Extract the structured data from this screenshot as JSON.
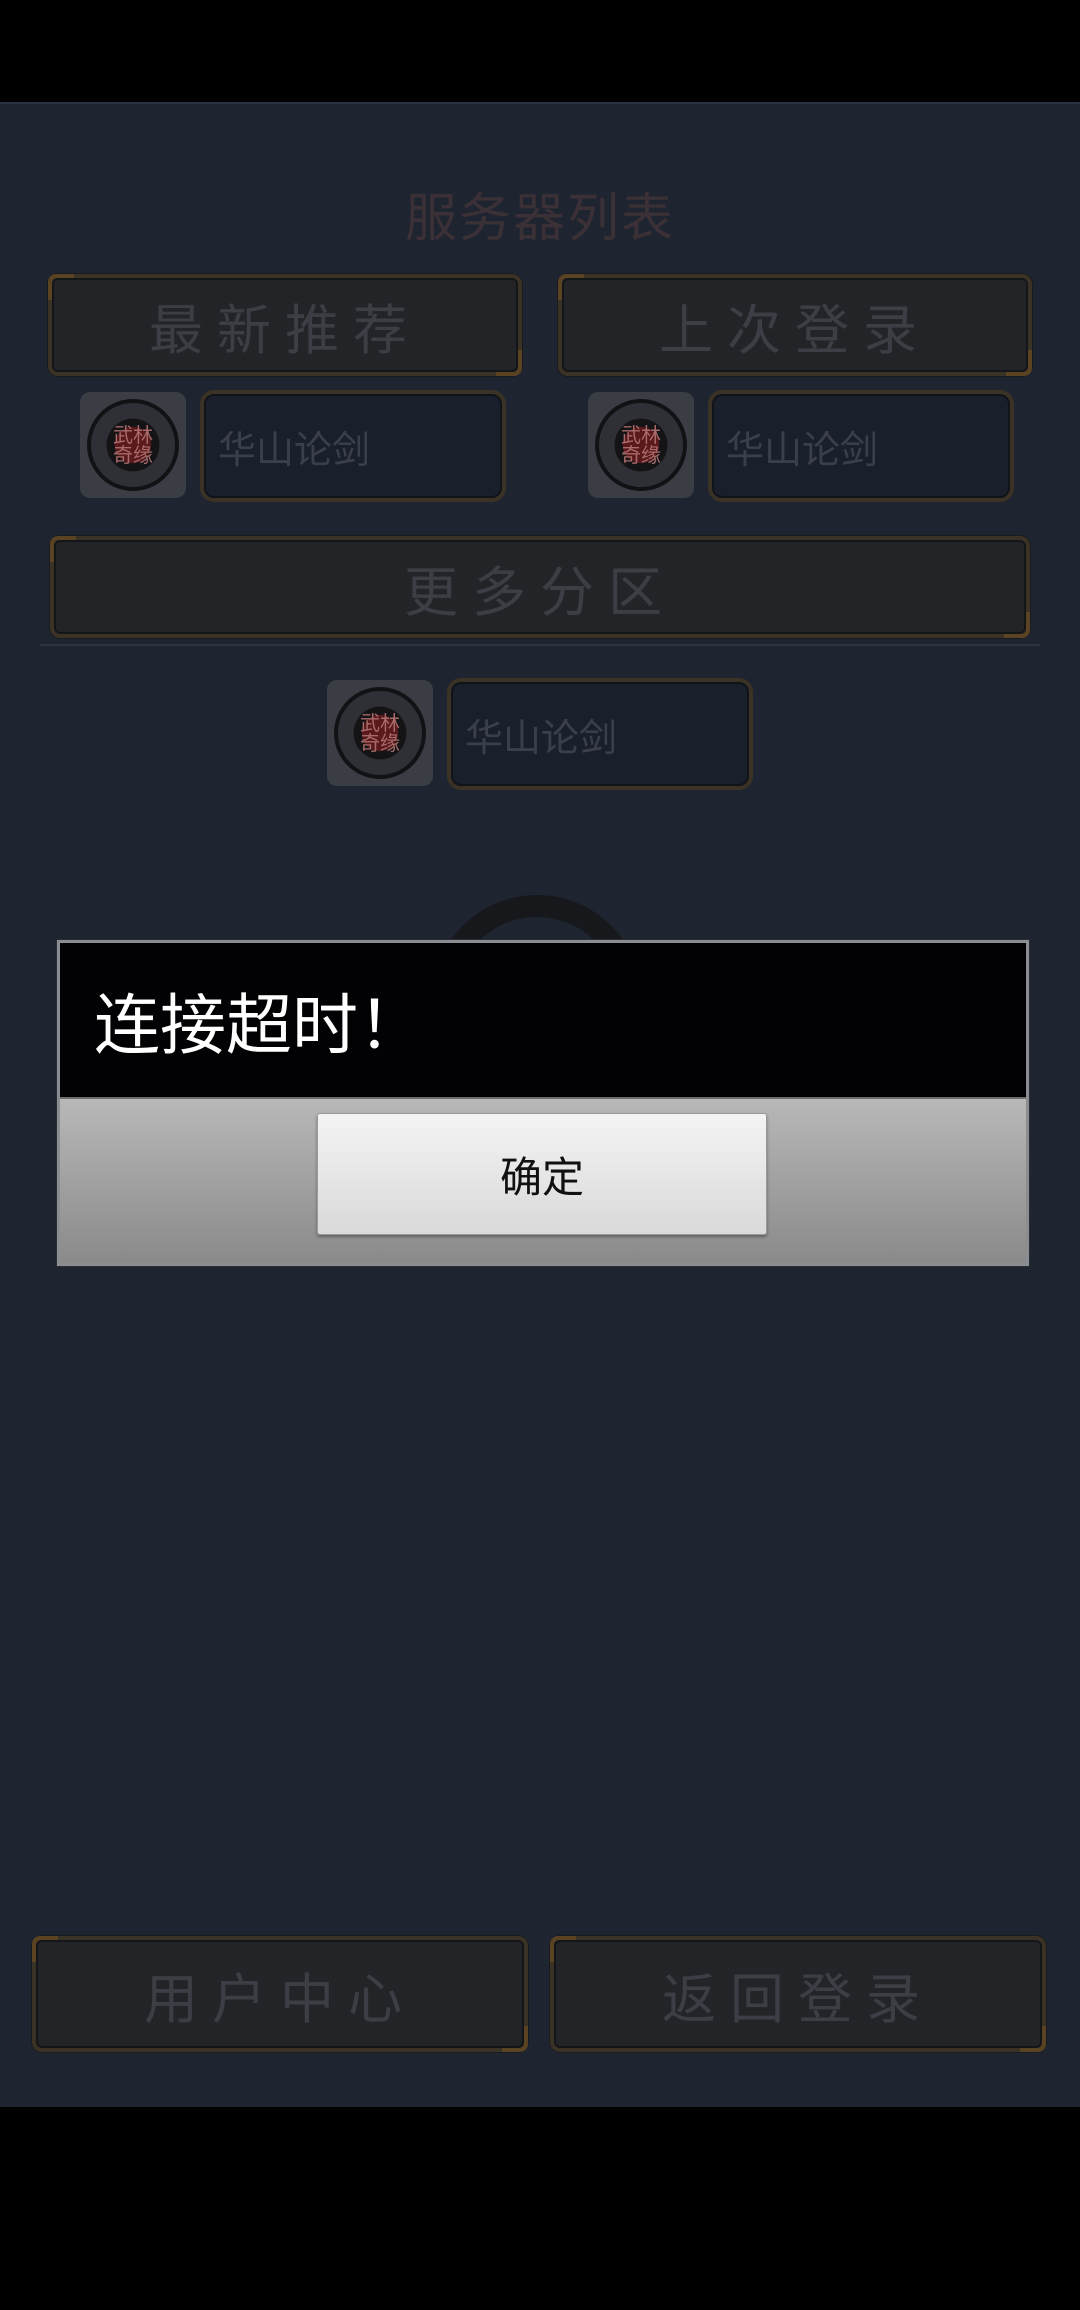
{
  "header": {
    "title": "服务器列表"
  },
  "tabs": {
    "recommended": "最新推荐",
    "last_login": "上次登录"
  },
  "servers": {
    "recommended": {
      "name": "华山论剑",
      "logo_text": "武林奇缘"
    },
    "last_login": {
      "name": "华山论剑",
      "logo_text": "武林奇缘"
    },
    "more_list": {
      "name": "华山论剑",
      "logo_text": "武林奇缘"
    }
  },
  "more_zones_label": "更多分区",
  "footer": {
    "user_center": "用户中心",
    "back_to_login": "返回登录"
  },
  "dialog": {
    "message": "连接超时！",
    "ok_label": "确定"
  },
  "colors": {
    "app_bg": "#1e2430",
    "dialog_message_bg": "#020204",
    "dialog_button_bg": "#e8e8e8",
    "frame_gold": "#5a4322"
  },
  "icons": {
    "server_logo": "wulin-seal-logo-icon",
    "loading": "loading-ring-icon"
  }
}
